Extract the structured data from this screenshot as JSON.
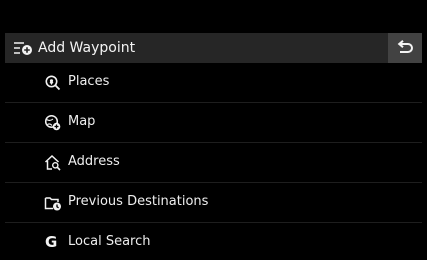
{
  "header": {
    "title": "Add Waypoint",
    "title_icon": "add-waypoint-icon",
    "back_icon": "back-arrow-icon"
  },
  "menu": {
    "items": [
      {
        "label": "Places",
        "icon": "places-search-icon"
      },
      {
        "label": "Map",
        "icon": "map-globe-icon"
      },
      {
        "label": "Address",
        "icon": "address-home-icon"
      },
      {
        "label": "Previous Destinations",
        "icon": "previous-destinations-folder-icon"
      },
      {
        "label": "Local Search",
        "icon": "google-g-icon",
        "icon_glyph": "G"
      }
    ]
  },
  "colors": {
    "background": "#000000",
    "header_bar": "#262626",
    "back_button": "#424242",
    "text": "#f2f2f2",
    "divider": "#1e1e1e"
  }
}
